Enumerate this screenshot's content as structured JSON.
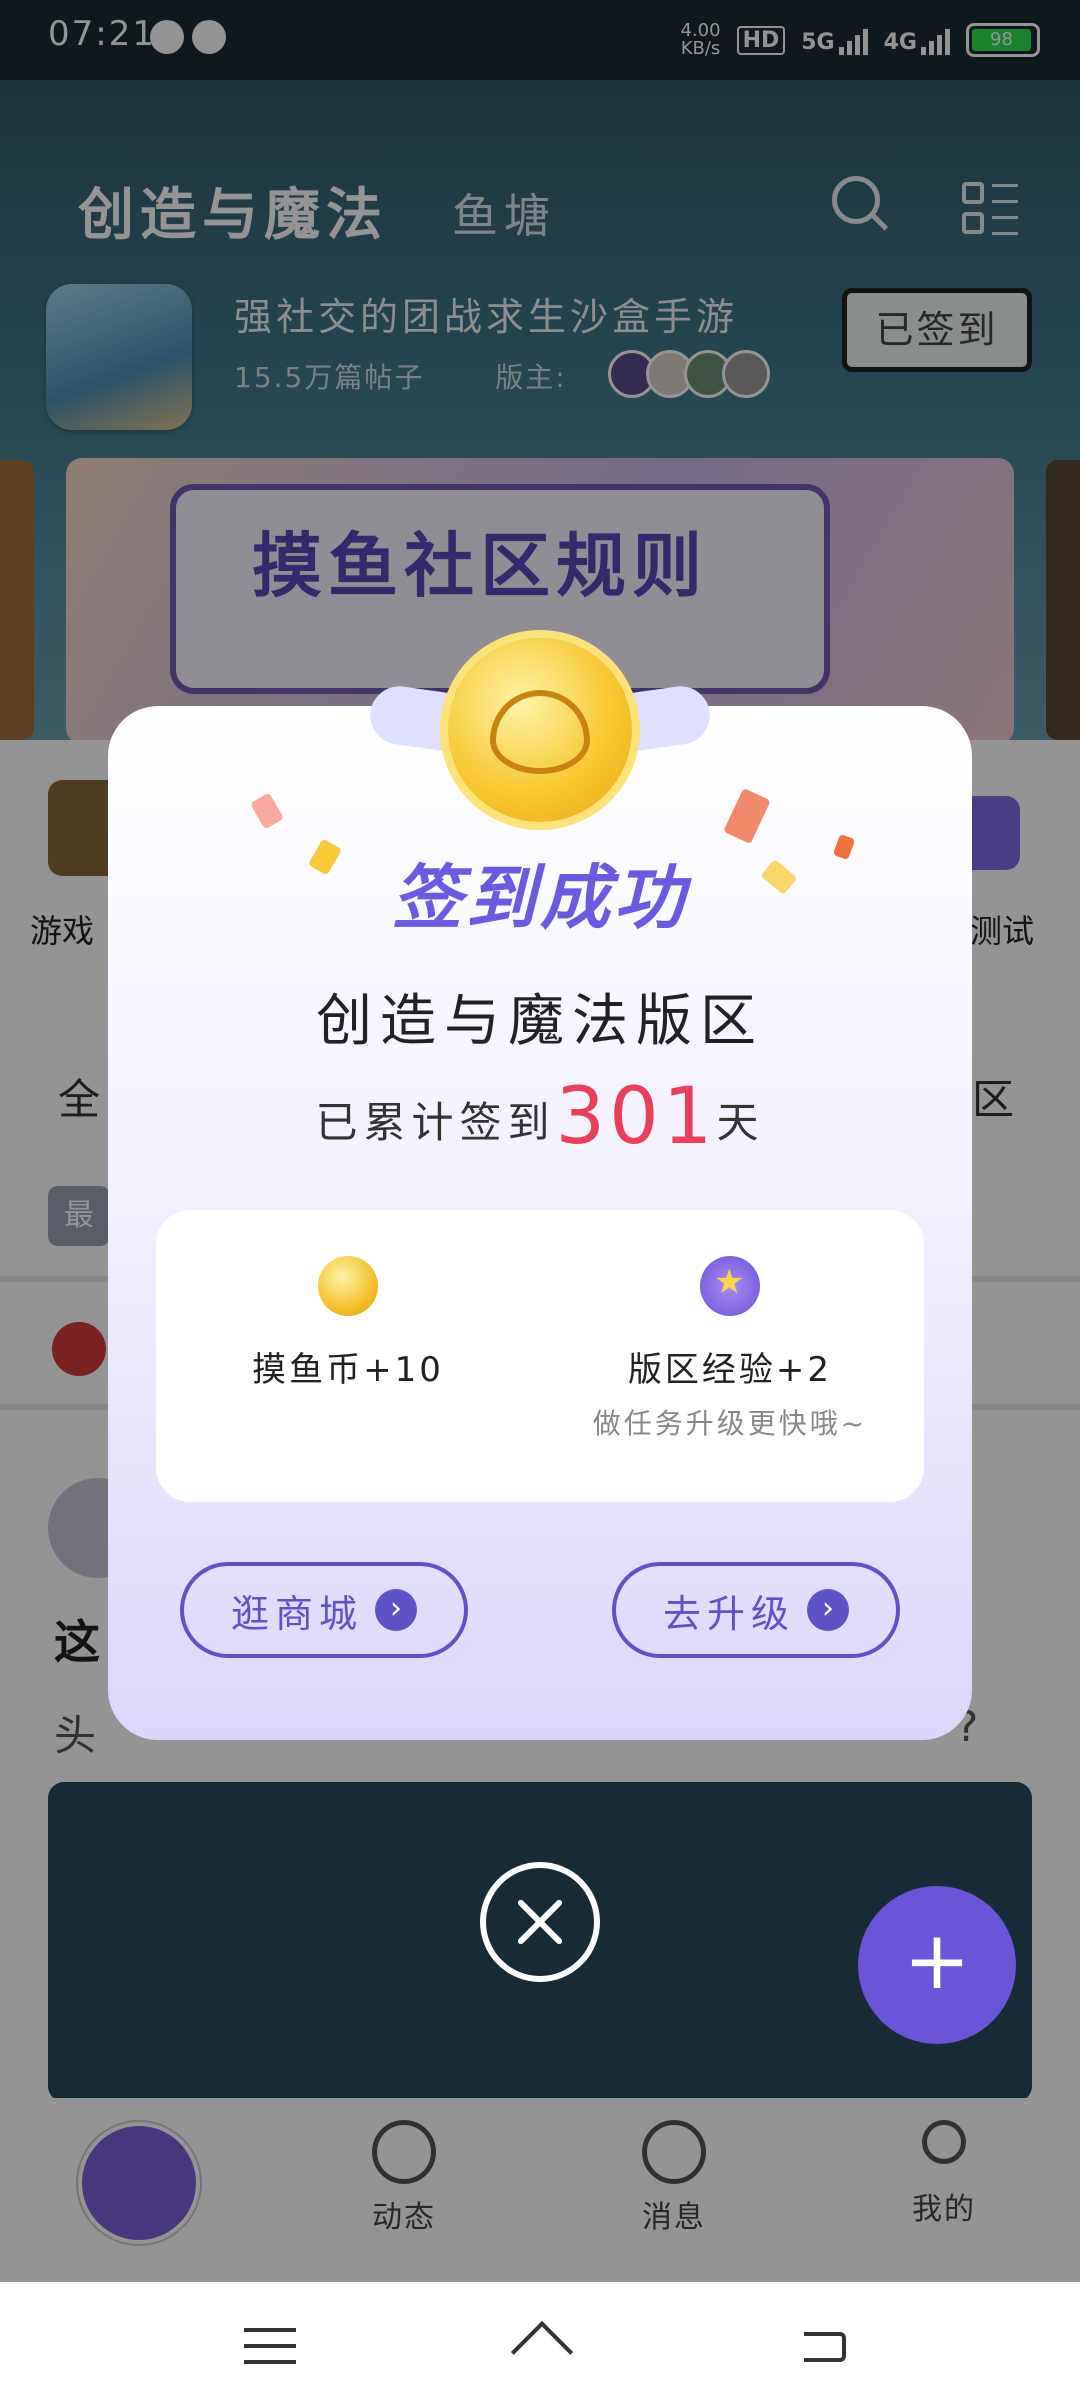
{
  "status_bar": {
    "time": "07:21",
    "speed": "4.00",
    "speed_unit": "KB/s",
    "hd": "HD",
    "net1": "5G",
    "net2": "4G",
    "battery": "98"
  },
  "header": {
    "title": "创造与魔法",
    "tab": "鱼塘",
    "search_icon": "search-icon",
    "menu_icon": "grid-menu-icon"
  },
  "forum": {
    "tagline": "强社交的团战求生沙盒手游",
    "posts": "15.5万篇帖子",
    "moderators_label": "版主:",
    "signed_button": "已签到"
  },
  "banner": {
    "title": "摸鱼社区规则"
  },
  "behind": {
    "cat_left": "游戏",
    "cat_right": "测试",
    "row_left": "全",
    "row_right": "区",
    "tag": "最",
    "post_lead": "这",
    "post_line": "头",
    "post_tail": "?"
  },
  "modal": {
    "success_title": "签到成功",
    "forum_name": "创造与魔法版区",
    "streak_prefix": "已累计签到",
    "streak_days": "301",
    "streak_suffix": "天",
    "reward1_label": "摸鱼币+10",
    "reward2_label": "版区经验+2",
    "reward2_hint": "做任务升级更快哦~",
    "button_shop": "逛商城",
    "button_upgrade": "去升级",
    "arrow": "›"
  },
  "fab": {
    "label": "+"
  },
  "bottom_nav": {
    "items": [
      {
        "label": "动态"
      },
      {
        "label": "消息"
      },
      {
        "label": "我的"
      }
    ]
  },
  "colors": {
    "accent": "#5f52c8",
    "streak": "#e8405a",
    "success": "#6a5ae0"
  }
}
